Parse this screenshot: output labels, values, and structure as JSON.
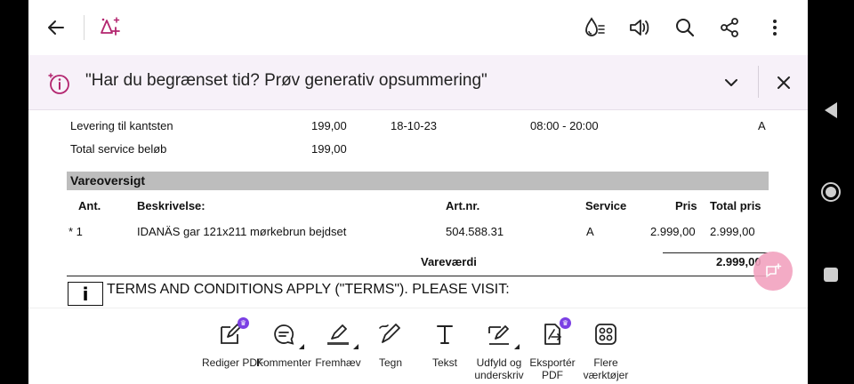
{
  "banner": {
    "text": "\"Har du begrænset tid? Prøv generativ opsummering\""
  },
  "document": {
    "service_rows": [
      {
        "desc": "Levering til kantsten",
        "amount": "199,00",
        "date": "18-10-23",
        "time": "08:00 - 20:00",
        "code": "A"
      },
      {
        "desc": "Total service beløb",
        "amount": "199,00"
      }
    ],
    "section_title": "Vareoversigt",
    "headers": {
      "ant": "Ant.",
      "desc": "Beskrivelse:",
      "artnr": "Art.nr.",
      "service": "Service",
      "pris": "Pris",
      "total": "Total pris"
    },
    "item": {
      "ant": "* 1",
      "desc": "IDANÄS gar 121x211 mørkebrun bejdset",
      "artnr": "504.588.31",
      "service": "A",
      "pris": "2.999,00",
      "total": "2.999,00"
    },
    "value_label": "Vareværdi",
    "value_amount": "2.999,00",
    "info_symbol": "i",
    "terms": "TERMS AND CONDITIONS APPLY (\"TERMS\").    PLEASE VISIT:"
  },
  "tools": [
    {
      "label": "Rediger PDF",
      "icon": "edit-pdf-icon",
      "premium": true
    },
    {
      "label": "Kommenter",
      "icon": "comment-icon",
      "premium": false
    },
    {
      "label": "Fremhæv",
      "icon": "highlight-icon",
      "premium": false
    },
    {
      "label": "Tegn",
      "icon": "draw-icon",
      "premium": false
    },
    {
      "label": "Tekst",
      "icon": "text-icon",
      "premium": false
    },
    {
      "label": "Udfyld og underskriv",
      "icon": "fill-sign-icon",
      "premium": false
    },
    {
      "label": "Eksportér PDF",
      "icon": "export-pdf-icon",
      "premium": true
    },
    {
      "label": "Flere værktøjer",
      "icon": "more-tools-icon",
      "premium": false
    }
  ],
  "colors": {
    "accent": "#b3256f",
    "premium": "#7b3fe4",
    "banner_bg": "#f7f1f9",
    "section_bar": "#bdbdbd"
  }
}
